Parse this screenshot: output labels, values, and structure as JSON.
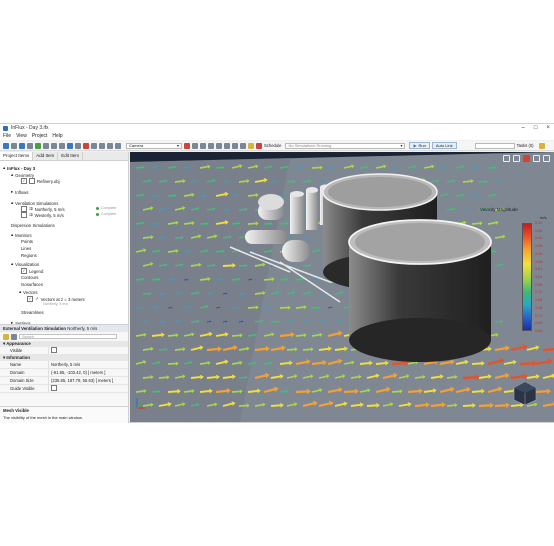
{
  "window": {
    "title": "InFlux - Day 3.ifx"
  },
  "menu": [
    "File",
    "View",
    "Project",
    "Help"
  ],
  "toolbar": {
    "camera_select": "Camera",
    "schedule_label": "Schedule",
    "status_select": "No Simulations Running",
    "run_label": "Run",
    "autolink_label": "Auto Link",
    "tasks_label": "Tasks (0)"
  },
  "left_tabs": [
    "Project Items",
    "Add Item",
    "Edit Item"
  ],
  "tree": {
    "root": "InFlux - Day 3",
    "geometry": "Geometry",
    "refinery": "Refinery.obj",
    "inflows": "Inflows",
    "vent_sims": "Ventilation Simulations",
    "sim1": "Northerly, 5 m/s",
    "sim2": "Westerly, 5 m/s",
    "sim_status": "Complete",
    "dispersion": "Dispersion Simulations",
    "monitors": "Monitors",
    "points": "Points",
    "lines": "Lines",
    "regions": "Regions",
    "visualization": "Visualization",
    "legend": "Legend",
    "contours": "Contours",
    "isosurfaces": "Isosurfaces",
    "vectors": "Vectors",
    "vectors_item": "Vectors at z = 3 meters",
    "vectors_sub": "Northerly, 5 m/s",
    "streamlines": "Streamlines",
    "settings": "Settings"
  },
  "properties": {
    "header": "External Ventilation Simulation",
    "header_value": "Northerly, 5 m/s",
    "search_placeholder": "Search",
    "appearance": "Appearance",
    "visible": "Visible",
    "information": "Information",
    "name_key": "Name",
    "name_val": "Northerly, 5 m/s",
    "domain_key": "Domain",
    "domain_val": "(-91.95, -103.42, 0) [ meters ]",
    "size_key": "Domain Size",
    "size_val": "(235.85, 187.79, 55.63) [ meters ]",
    "guide_key": "Guide Visible",
    "help_title": "Mesh Visible",
    "help_text": "The visibility of the mesh in the main window."
  },
  "legend": {
    "title": "Velocity Magnitude",
    "unit": "m/s",
    "ticks": [
      "6.22",
      "5.94",
      "5.42",
      "4.98",
      "4.45",
      "3.98",
      "3.51",
      "3.04",
      "2.58",
      "2.11",
      "1.64",
      "1.18",
      "0.71",
      "0.93",
      "0.00"
    ]
  },
  "colors": {
    "accent": "#3a78c2",
    "sky": "#1d2b3d",
    "ground": "#7d8590"
  }
}
